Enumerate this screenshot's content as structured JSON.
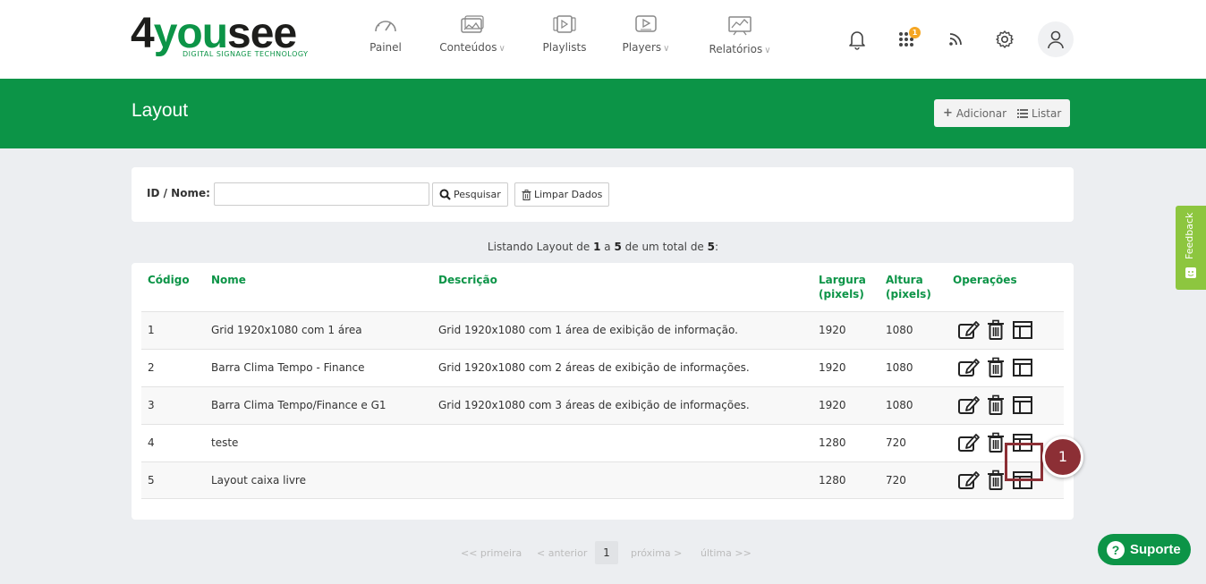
{
  "brand": {
    "logo_prefix": "4",
    "logo_you": "you",
    "logo_see": "see",
    "tagline": "DIGITAL SIGNAGE TECHNOLOGY"
  },
  "nav": {
    "items": [
      {
        "label": "Painel",
        "icon": "gauge-icon",
        "dropdown": false
      },
      {
        "label": "Conteúdos",
        "icon": "images-icon",
        "dropdown": true
      },
      {
        "label": "Playlists",
        "icon": "playlist-icon",
        "dropdown": false
      },
      {
        "label": "Players",
        "icon": "player-icon",
        "dropdown": true
      },
      {
        "label": "Relatórios",
        "icon": "report-chart-icon",
        "dropdown": true
      }
    ],
    "notification_count": "1"
  },
  "header": {
    "title": "Layout",
    "add_label": "Adicionar",
    "list_label": "Listar"
  },
  "search": {
    "label": "ID / Nome:",
    "value": "",
    "search_label": "Pesquisar",
    "clear_label": "Limpar Dados"
  },
  "listing": {
    "prefix": "Listando Layout de",
    "from": "1",
    "to_word": "a",
    "to": "5",
    "total_prefix": "de um total de",
    "total": "5",
    "suffix": ":"
  },
  "table": {
    "columns": {
      "code": "Código",
      "name": "Nome",
      "description": "Descrição",
      "width_line1": "Largura",
      "width_line2": "(pixels)",
      "height_line1": "Altura",
      "height_line2": "(pixels)",
      "operations": "Operações"
    },
    "rows": [
      {
        "code": "1",
        "name": "Grid 1920x1080 com 1 área",
        "description": "Grid 1920x1080 com 1 área de exibição de informação.",
        "width": "1920",
        "height": "1080"
      },
      {
        "code": "2",
        "name": "Barra Clima Tempo - Finance",
        "description": "Grid 1920x1080 com 2 áreas de exibição de informações.",
        "width": "1920",
        "height": "1080"
      },
      {
        "code": "3",
        "name": "Barra Clima Tempo/Finance e G1",
        "description": "Grid 1920x1080 com 3 áreas de exibição de informações.",
        "width": "1920",
        "height": "1080"
      },
      {
        "code": "4",
        "name": "teste",
        "description": "",
        "width": "1280",
        "height": "720"
      },
      {
        "code": "5",
        "name": "Layout caixa livre",
        "description": "",
        "width": "1280",
        "height": "720"
      }
    ]
  },
  "annotation": {
    "step": "1"
  },
  "pagination": {
    "first": "<< primeira",
    "prev": "< anterior",
    "current": "1",
    "next": "próxima >",
    "last": "última >>"
  },
  "feedback": {
    "label": "Feedback"
  },
  "support": {
    "label": "Suporte",
    "icon_text": "?"
  },
  "colors": {
    "brand_green": "#0c9447",
    "feedback_green": "#8dc63f",
    "annotation": "#8c2f35",
    "badge": "#f5a623"
  }
}
